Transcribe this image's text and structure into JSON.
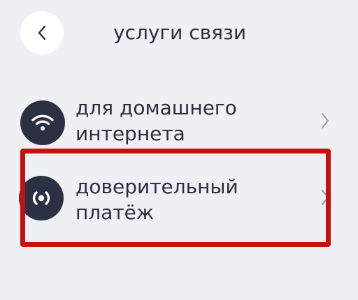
{
  "header": {
    "back_icon": "chevron-left-icon",
    "title": "услуги связи"
  },
  "items": [
    {
      "icon": "wifi-icon",
      "label_line1": "для домашнего",
      "label_line2": "интернета",
      "chevron_icon": "chevron-right-icon"
    },
    {
      "icon": "trust-payment-icon",
      "label_line1": "доверительный",
      "label_line2": "платёж",
      "chevron_icon": "chevron-right-icon"
    }
  ],
  "colors": {
    "background": "#eef0f4",
    "icon_circle": "#2b3142",
    "text": "#2b2f3a",
    "chevron": "#9aa0aa",
    "highlight": "#c4100e"
  }
}
